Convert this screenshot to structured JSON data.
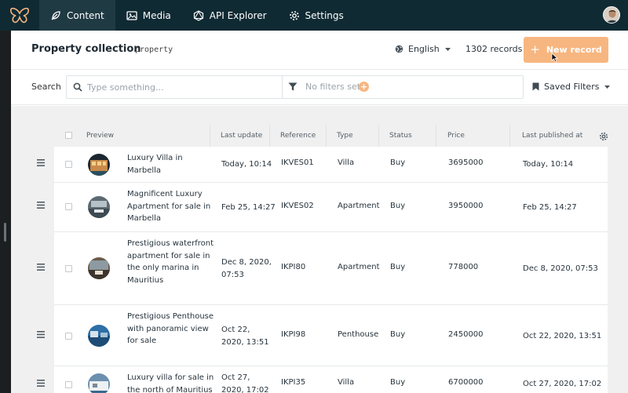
{
  "nav": {
    "items": [
      {
        "label": "Content",
        "icon": "feather-icon",
        "active": true
      },
      {
        "label": "Media",
        "icon": "image-icon",
        "active": false
      },
      {
        "label": "API Explorer",
        "icon": "graphql-icon",
        "active": false
      },
      {
        "label": "Settings",
        "icon": "gear-icon",
        "active": false
      }
    ]
  },
  "header": {
    "title": "Property collection",
    "slug": "property",
    "language": "English",
    "records": "1302 records",
    "new_button": "New record"
  },
  "search": {
    "label": "Search",
    "placeholder": "Type something...",
    "filters_text": "No filters set",
    "saved_filters": "Saved Filters"
  },
  "table": {
    "columns": [
      "Preview",
      "Last update",
      "Reference",
      "Type",
      "Status",
      "Price",
      "Last published at"
    ],
    "rows": [
      {
        "preview": "Luxury Villa in Marbella",
        "last_update": "Today, 10:14",
        "reference": "IKVES01",
        "type": "Villa",
        "status": "Buy",
        "price": "3695000",
        "published": "Today, 10:14"
      },
      {
        "preview": "Magnificent Luxury Apartment for sale in Marbella",
        "last_update": "Feb 25, 14:27",
        "reference": "IKVES02",
        "type": "Apartment",
        "status": "Buy",
        "price": "3950000",
        "published": "Feb 25, 14:27"
      },
      {
        "preview": "Prestigious waterfront apartment for sale in the only marina in Mauritius",
        "last_update": "Dec 8, 2020, 07:53",
        "reference": "IKPI80",
        "type": "Apartment",
        "status": "Buy",
        "price": "778000",
        "published": "Dec 8, 2020, 07:53"
      },
      {
        "preview": "Prestigious Penthouse with panoramic view for sale",
        "last_update": "Oct 22, 2020, 13:51",
        "reference": "IKPI98",
        "type": "Penthouse",
        "status": "Buy",
        "price": "2450000",
        "published": "Oct 22, 2020, 13:51"
      },
      {
        "preview": "Luxury villa for sale in the north of Mauritius",
        "last_update": "Oct 27, 2020, 17:02",
        "reference": "IKPI35",
        "type": "Villa",
        "status": "Buy",
        "price": "6700000",
        "published": "Oct 27, 2020, 17:02"
      }
    ]
  },
  "colors": {
    "nav_bg": "#102a33",
    "accent": "#f7b680",
    "content_bg": "#f0f0f0"
  }
}
